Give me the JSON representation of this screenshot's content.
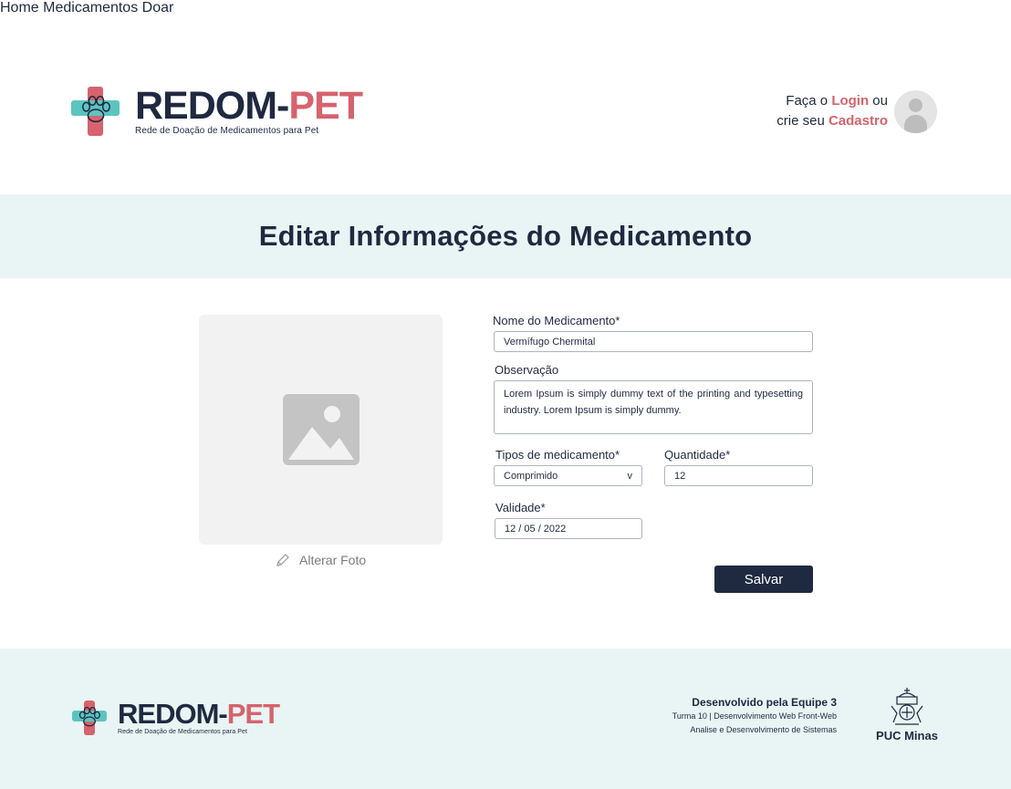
{
  "brand": {
    "title_a": "REDOM-",
    "title_b": "PET",
    "subtitle": "Rede de Doação de Medicamentos para Pet",
    "colors": {
      "navy": "#1f2940",
      "coral": "#d6636d",
      "teal": "#5cc4c0",
      "band": "#e8f5f4"
    }
  },
  "nav": {
    "home": "Home",
    "medicamentos": "Medicamentos",
    "doar": "Doar"
  },
  "auth": {
    "line1_pre": "Faça o ",
    "login": "Login",
    "line1_post": " ou",
    "line2_pre": "crie seu ",
    "cadastro": "Cadastro",
    "avatar_icon": "user-avatar-icon"
  },
  "page": {
    "title": "Editar Informações do Medicamento"
  },
  "form": {
    "photo_icon": "image-placeholder-icon",
    "alter_photo": "Alterar Foto",
    "name_label": "Nome do Medicamento*",
    "name_value": "Vermífugo Chermital",
    "obs_label": "Observação",
    "obs_value": "Lorem Ipsum is simply dummy text of the printing and typesetting industry. Lorem Ipsum is simply dummy.",
    "type_label": "Tipos de medicamento*",
    "type_value": "Comprimido",
    "type_arrow": "v",
    "qty_label": "Quantidade*",
    "qty_value": "12",
    "validity_label": "Validade*",
    "validity_value": "12 / 05 / 2022",
    "save": "Salvar"
  },
  "footer": {
    "credit_title": "Desenvolvido pela Equipe 3",
    "credit_line2": "Turma 10 | Desenvolvimento Web Front-Web",
    "credit_line3": "Analise e Desenvolvimento de Sistemas",
    "puc": "PUC Minas"
  }
}
